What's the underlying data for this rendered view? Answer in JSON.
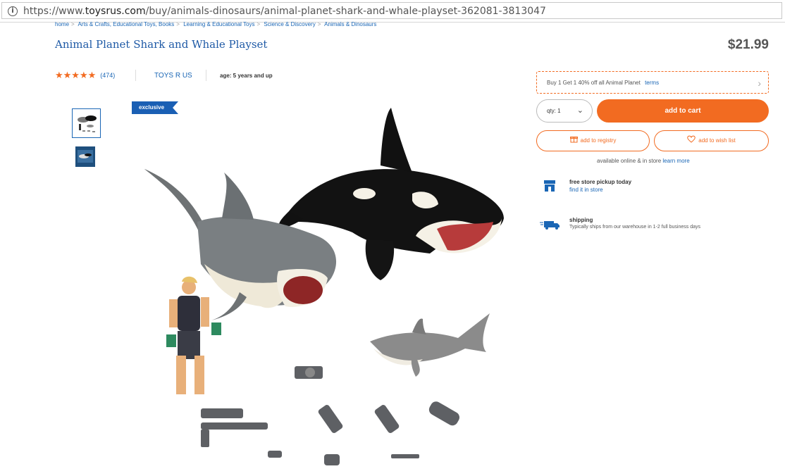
{
  "browser": {
    "url_prefix": "https://www.",
    "url_domain": "toysrus.com",
    "url_path": "/buy/animals-dinosaurs/animal-planet-shark-and-whale-playset-362081-3813047",
    "info_icon": "info-icon"
  },
  "breadcrumb": [
    "home",
    "Arts & Crafts, Educational Toys, Books",
    "Learning & Educational Toys",
    "Science & Discovery",
    "Animals & Dinosaurs"
  ],
  "breadcrumb_sep": ">",
  "product": {
    "title": "Animal Planet Shark and Whale Playset",
    "price": "$21.99",
    "stars": "★★★★★",
    "reviews": "(474)",
    "rating": 4.5,
    "brand": "TOYS R US",
    "age": "age: 5 years and up",
    "badge": "exclusive"
  },
  "promo": {
    "text": "Buy 1 Get 1 40% off all Animal Planet",
    "terms": "terms",
    "chevron": "›"
  },
  "purchase": {
    "qty_label": "qty: 1",
    "qty_chevron": "⌄",
    "add_to_cart": "add to cart",
    "registry": "add to registry",
    "wishlist": "add to wish list",
    "avail_text": "available online & in store",
    "learn_more": "learn more"
  },
  "pickup": {
    "title": "free store pickup today",
    "link": "find it in store"
  },
  "shipping": {
    "title": "shipping",
    "subtitle": "Typically ships from our warehouse in 1-2 full business days"
  },
  "colors": {
    "accent": "#f26b21",
    "link": "#1a66b5",
    "badge": "#1a5fb4"
  }
}
